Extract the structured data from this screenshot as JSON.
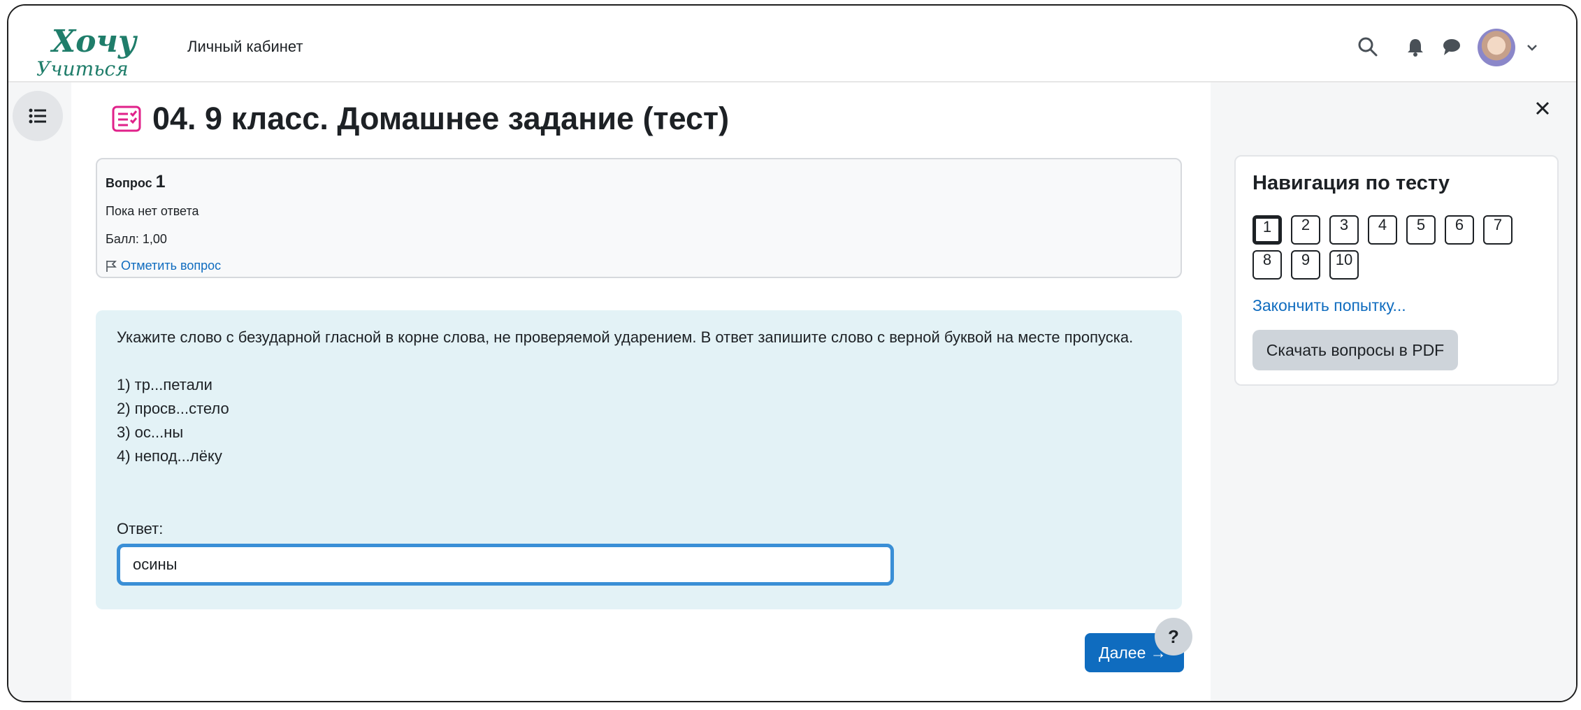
{
  "header": {
    "logo_text_top": "Хочу",
    "logo_text_bottom": "Учиться",
    "title": "Личный кабинет",
    "icons": [
      "search-icon",
      "bell-icon",
      "chat-icon",
      "avatar",
      "chevron-down-icon"
    ]
  },
  "page": {
    "title": "04. 9 класс. Домашнее задание (тест)",
    "title_icon": "quiz-icon"
  },
  "question_info": {
    "label": "Вопрос",
    "number": "1",
    "state": "Пока нет ответа",
    "grade": "Балл: 1,00",
    "flag_label": "Отметить вопрос"
  },
  "question": {
    "text_line1": "Укажите слово с безударной гласной в корне слова, не проверяемой ударением. В ответ запишите слово с верной буквой на месте пропуска.",
    "options": [
      "1) тр...петали",
      "2) просв...стело",
      "3) ос...ны",
      "4) непод...лёку"
    ],
    "answer_label": "Ответ:",
    "answer_value": "осины"
  },
  "navigation": {
    "title": "Навигация по тесту",
    "questions": [
      "1",
      "2",
      "3",
      "4",
      "5",
      "6",
      "7",
      "8",
      "9",
      "10"
    ],
    "current": "1",
    "finish_link": "Закончить попытку...",
    "pdf_button": "Скачать вопросы в PDF"
  },
  "footer": {
    "next_button": "Далее →",
    "help_button": "?"
  },
  "colors": {
    "accent": "#0f6cbf",
    "logo_green": "#1f7d6a",
    "quiz_icon": "#e0218a",
    "formulation_bg": "#e3f2f6"
  }
}
